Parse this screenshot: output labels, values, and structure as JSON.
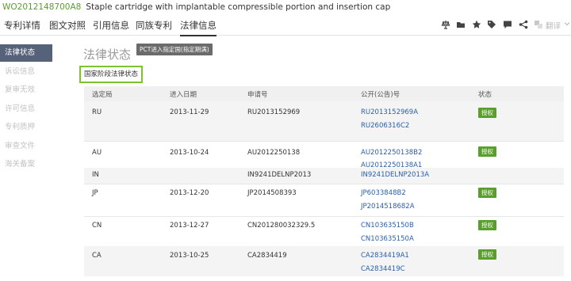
{
  "header": {
    "pub_id": "WO2012148700A8",
    "title": "Staple cartridge with implantable compressible portion and insertion cap"
  },
  "nav": {
    "tabs": [
      {
        "label": "专利详情",
        "active": false
      },
      {
        "label": "图文对照",
        "active": false
      },
      {
        "label": "引用信息",
        "active": false
      },
      {
        "label": "同族专利",
        "active": false
      },
      {
        "label": "法律信息",
        "active": true
      }
    ],
    "tools": [
      "translate-pin-icon",
      "folder-icon",
      "star-icon",
      "tag-icon",
      "comment-icon",
      "share-icon",
      "translate-icon"
    ],
    "translate_label": "翻译"
  },
  "sidebar": {
    "items": [
      {
        "label": "法律状态",
        "active": true
      },
      {
        "label": "诉讼信息",
        "active": false
      },
      {
        "label": "复审无效",
        "active": false
      },
      {
        "label": "许可信息",
        "active": false
      },
      {
        "label": "专利质押",
        "active": false
      },
      {
        "label": "审查文件",
        "active": false
      },
      {
        "label": "海关备案",
        "active": false
      }
    ]
  },
  "main": {
    "title": "法律状态",
    "pct_button": "PCT进入指定国(指定期满)",
    "stage_button": "国家阶段法律状态",
    "columns": [
      "选定局",
      "进入日期",
      "申请号",
      "公开(公告)号",
      "状态"
    ],
    "rows": [
      {
        "office": "RU",
        "date": "2013-11-29",
        "app_no": "RU2013152969",
        "pubs": [
          "RU2013152969A",
          "RU2606316C2"
        ],
        "status": "授权"
      },
      {
        "office": "AU",
        "date": "2013-10-24",
        "app_no": "AU2012250138",
        "pubs": [
          "AU2012250138B2",
          "AU2012250138A1"
        ],
        "status": "授权"
      },
      {
        "office": "IN",
        "date": "",
        "app_no": "IN9241DELNP2013",
        "pubs": [
          "IN9241DELNP2013A"
        ],
        "status": ""
      },
      {
        "office": "JP",
        "date": "2013-12-20",
        "app_no": "JP2014508393",
        "pubs": [
          "JP6033848B2",
          "JP2014518682A"
        ],
        "status": "授权"
      },
      {
        "office": "CN",
        "date": "2013-12-27",
        "app_no": "CN201280032329.5",
        "pubs": [
          "CN103635150B",
          "CN103635150A"
        ],
        "status": "授权"
      },
      {
        "office": "CA",
        "date": "2013-10-25",
        "app_no": "CA2834419",
        "pubs": [
          "CA2834419A1",
          "CA2834419C"
        ],
        "status": "授权"
      }
    ]
  },
  "colors": {
    "accent_green": "#5a9e2e",
    "stage_border": "#7dc32b",
    "link_blue": "#2b5ea8",
    "sidebar_active": "#56617a"
  }
}
